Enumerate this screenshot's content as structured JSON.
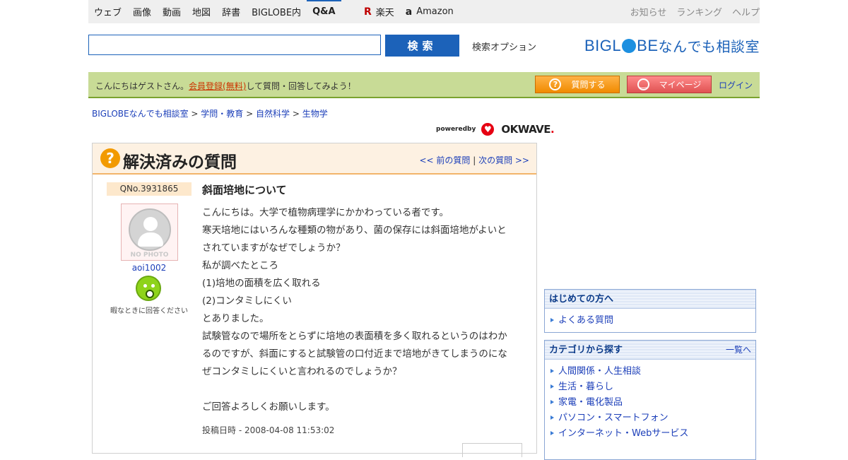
{
  "topnav": {
    "items": [
      "ウェブ",
      "画像",
      "動画",
      "地図",
      "辞書",
      "BIGLOBE内",
      "Q&A"
    ],
    "shop": [
      {
        "icon": "rakuten-icon",
        "label": "楽天"
      },
      {
        "icon": "amazon-icon",
        "label": "Amazon"
      }
    ],
    "right": [
      "お知らせ",
      "ランキング",
      "ヘルプ"
    ]
  },
  "search": {
    "value": "",
    "button": "検索",
    "options": "検索オプション"
  },
  "logo": {
    "text_a": "BIGL",
    "text_b": "BE",
    "text_c": "なんでも相談室"
  },
  "greenbar": {
    "greet_before": "こんにちはゲストさん。",
    "register_link": "会員登録(無料)",
    "greet_after": "して質問・回答してみよう！",
    "ask_button": "質問する",
    "mypage_button": "マイページ",
    "login": "ログイン"
  },
  "breadcrumb": [
    "BIGLOBEなんでも相談室",
    "学問・教育",
    "自然科学",
    "生物学"
  ],
  "poweredby": {
    "label": "poweredby",
    "brand_a": "OKWAVE",
    "brand_b": "."
  },
  "question": {
    "panel_title": "解決済みの質問",
    "prev": "<< 前の質問",
    "next": "次の質問 >>",
    "number": "QNo.3931865",
    "avatar_text": "NO PHOTO",
    "username": "aoi1002",
    "user_status": "暇なときに回答ください",
    "subject": "斜面培地について",
    "body": [
      "こんにちは。大学で植物病理学にかかわっている者です。",
      "寒天培地にはいろんな種類の物があり、菌の保存には斜面培地がよいと",
      "されていますがなぜでしょうか？",
      "私が調べたところ",
      "(1)培地の面積を広く取れる",
      "(2)コンタミしにくい",
      "とありました。",
      "試験管なので場所をとらずに培地の表面積を多く取れるというのはわか",
      "るのですが、斜面にすると試験管の口付近まで培地がきてしまうのにな",
      "ぜコンタミしにくいと言われるのでしょうか？",
      "",
      "ご回答よろしくお願いします。"
    ],
    "date": "投稿日時 - 2008-04-08 11:53:02"
  },
  "sidebar": {
    "beginners": {
      "title": "はじめての方へ",
      "items": [
        "よくある質問"
      ]
    },
    "categories": {
      "title": "カテゴリから探す",
      "more": "一覧へ",
      "items": [
        "人間関係・人生相談",
        "生活・暮らし",
        "家電・電化製品",
        "パソコン・スマートフォン",
        "インターネット・Webサービス"
      ]
    }
  }
}
